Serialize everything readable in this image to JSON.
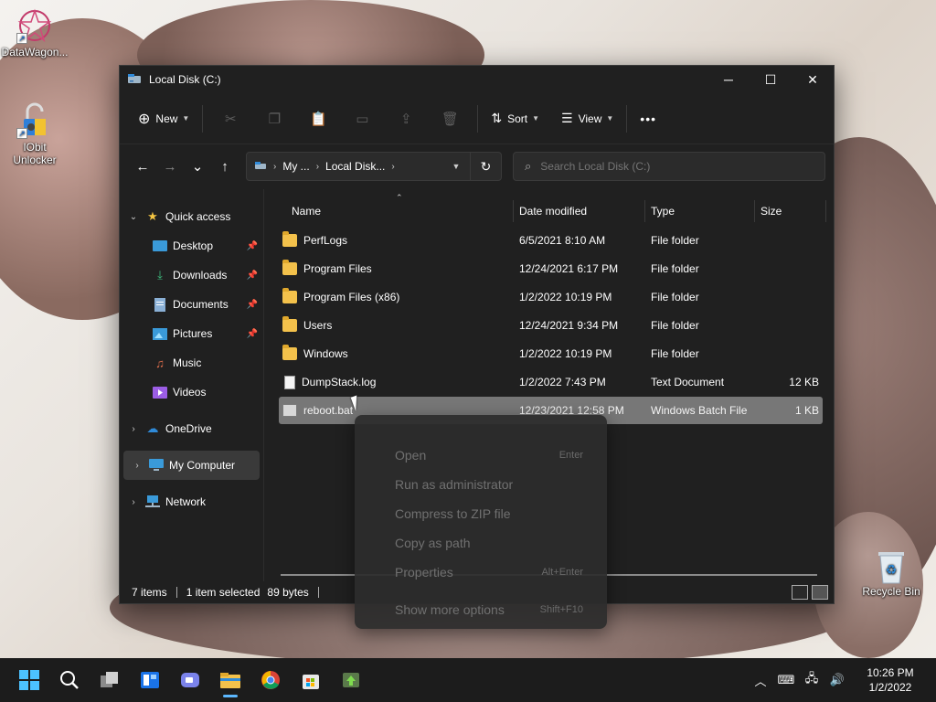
{
  "desktop": {
    "icons": [
      {
        "label": "DataWagon..."
      },
      {
        "label": "IObit Unlocker"
      },
      {
        "label": "Recycle Bin"
      }
    ]
  },
  "window": {
    "title": "Local Disk (C:)",
    "controls": {
      "minimize": "─",
      "maximize": "☐",
      "close": "✕"
    }
  },
  "toolbar": {
    "new_label": "New",
    "sort_label": "Sort",
    "view_label": "View",
    "more_label": "•••"
  },
  "navigation": {
    "back": "←",
    "forward": "→",
    "recent": "⌄",
    "up": "↑"
  },
  "address": {
    "crumbs": [
      "My ...",
      "Local Disk..."
    ],
    "refresh": "↻"
  },
  "search": {
    "placeholder": "Search Local Disk (C:)"
  },
  "sidebar": {
    "quick_access": "Quick access",
    "items": [
      {
        "label": "Desktop"
      },
      {
        "label": "Downloads"
      },
      {
        "label": "Documents"
      },
      {
        "label": "Pictures"
      },
      {
        "label": "Music"
      },
      {
        "label": "Videos"
      }
    ],
    "onedrive": "OneDrive",
    "my_computer": "My Computer",
    "network": "Network"
  },
  "columns": {
    "name": "Name",
    "date": "Date modified",
    "type": "Type",
    "size": "Size"
  },
  "files": [
    {
      "name": "PerfLogs",
      "date": "6/5/2021 8:10 AM",
      "type": "File folder",
      "size": ""
    },
    {
      "name": "Program Files",
      "date": "12/24/2021 6:17 PM",
      "type": "File folder",
      "size": ""
    },
    {
      "name": "Program Files (x86)",
      "date": "1/2/2022 10:19 PM",
      "type": "File folder",
      "size": ""
    },
    {
      "name": "Users",
      "date": "12/24/2021 9:34 PM",
      "type": "File folder",
      "size": ""
    },
    {
      "name": "Windows",
      "date": "1/2/2022 10:19 PM",
      "type": "File folder",
      "size": ""
    },
    {
      "name": "DumpStack.log",
      "date": "1/2/2022 7:43 PM",
      "type": "Text Document",
      "size": "12 KB"
    },
    {
      "name": "reboot.bat",
      "date": "12/23/2021 12:58 PM",
      "type": "Windows Batch File",
      "size": "1 KB"
    }
  ],
  "status": {
    "items": "7 items",
    "selected": "1 item selected",
    "bytes": "89 bytes"
  },
  "context_menu": {
    "items": [
      {
        "label": "Open",
        "shortcut": "Enter"
      },
      {
        "label": "Run as administrator",
        "shortcut": ""
      },
      {
        "label": "Compress to ZIP file",
        "shortcut": ""
      },
      {
        "label": "Copy as path",
        "shortcut": ""
      },
      {
        "label": "Properties",
        "shortcut": "Alt+Enter"
      },
      {
        "label": "Show more options",
        "shortcut": "Shift+F10"
      }
    ]
  },
  "taskbar": {
    "time": "10:26 PM",
    "date": "1/2/2022"
  },
  "colors": {
    "accent": "#5cb8ff",
    "folder": "#f3c14b",
    "window_bg": "#202020"
  }
}
